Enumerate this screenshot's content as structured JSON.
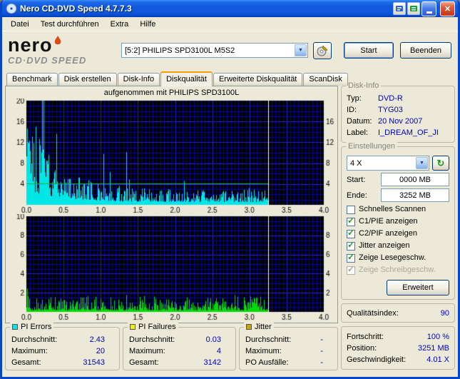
{
  "window": {
    "title": "Nero CD-DVD Speed 4.7.7.3"
  },
  "icons": {
    "chevron_down": "▼",
    "refresh": "↻",
    "close": "✕",
    "write_test": "✎"
  },
  "menu": {
    "items": [
      "Datei",
      "Test durchführen",
      "Extra",
      "Hilfe"
    ]
  },
  "logo": {
    "line1": "nero",
    "line2": "CD·DVD SPEED"
  },
  "toolbar": {
    "drive": "[5:2]  PHILIPS SPD3100L M5S2",
    "start_label": "Start",
    "quit_label": "Beenden"
  },
  "tabs": {
    "items": [
      "Benchmark",
      "Disk erstellen",
      "Disk-Info",
      "Diskqualität",
      "Erweiterte Diskqualität",
      "ScanDisk"
    ],
    "active_index": 3
  },
  "disk_info": {
    "title": "Disk-Info",
    "rows": [
      {
        "label": "Typ:",
        "value": "DVD-R"
      },
      {
        "label": "ID:",
        "value": "TYG03"
      },
      {
        "label": "Datum:",
        "value": "20 Nov 2007"
      },
      {
        "label": "Label:",
        "value": "I_DREAM_OF_JI"
      }
    ]
  },
  "settings": {
    "title": "Einstellungen",
    "speed_value": "4 X",
    "start_label": "Start:",
    "start_value": "0000 MB",
    "end_label": "Ende:",
    "end_value": "3252 MB",
    "checkboxes": [
      {
        "label": "Schnelles Scannen",
        "checked": false,
        "disabled": false
      },
      {
        "label": "C1/PIE anzeigen",
        "checked": true,
        "disabled": false
      },
      {
        "label": "C2/PIF anzeigen",
        "checked": true,
        "disabled": false
      },
      {
        "label": "Jitter anzeigen",
        "checked": true,
        "disabled": false
      },
      {
        "label": "Zeige Lesegeschw.",
        "checked": true,
        "disabled": false
      },
      {
        "label": "Zeige Schreibgeschw.",
        "checked": true,
        "disabled": true
      }
    ],
    "advanced_label": "Erweitert"
  },
  "quality": {
    "label": "Qualitätsindex:",
    "value": "90"
  },
  "progress": {
    "rows": [
      {
        "label": "Fortschritt:",
        "value": "100 %"
      },
      {
        "label": "Position:",
        "value": "3251 MB"
      },
      {
        "label": "Geschwindigkeit:",
        "value": "4.01 X"
      }
    ]
  },
  "stats": [
    {
      "title": "PI Errors",
      "color": "#00E6E6",
      "rows": [
        {
          "label": "Durchschnitt:",
          "value": "2.43"
        },
        {
          "label": "Maximum:",
          "value": "20"
        },
        {
          "label": "Gesamt:",
          "value": "31543"
        }
      ]
    },
    {
      "title": "PI Failures",
      "color": "#F0F000",
      "rows": [
        {
          "label": "Durchschnitt:",
          "value": "0.03"
        },
        {
          "label": "Maximum:",
          "value": "4"
        },
        {
          "label": "Gesamt:",
          "value": "3142"
        }
      ]
    },
    {
      "title": "Jitter",
      "color": "#C8A800",
      "rows": [
        {
          "label": "Durchschnitt:",
          "value": "-"
        },
        {
          "label": "Maximum:",
          "value": "-"
        },
        {
          "label": "PO Ausfälle:",
          "value": "-"
        }
      ]
    }
  ],
  "chart_data": [
    {
      "type": "area",
      "name": "pie",
      "title": "aufgenommen mit PHILIPS SPD3100L",
      "ylim": [
        0,
        20
      ],
      "xlim": [
        0,
        4
      ],
      "left_ticks": [
        4,
        8,
        12,
        16,
        20
      ],
      "right_ticks": [
        4,
        8,
        12,
        16
      ],
      "x_ticks": [
        "0.0",
        "0.5",
        "1.0",
        "1.5",
        "2.0",
        "2.5",
        "3.0",
        "3.5",
        "4.0"
      ],
      "hstep": 1,
      "hmajor": 4,
      "data_end_x": 3.25,
      "bg": "#000000",
      "grid": "#0000A0",
      "grid_major": "#2020D8",
      "seed": 20071120,
      "series": [
        {
          "name": "PI Errors",
          "color": "#00E6E6",
          "average": 2.43,
          "maximum": 20,
          "total": 31543
        },
        {
          "name": "Lesegeschwindigkeit",
          "color": "#00B43C",
          "type": "line",
          "speed_x": 4.01
        }
      ],
      "speed_line": 4.1
    },
    {
      "type": "area",
      "name": "pif",
      "ylim": [
        0,
        10
      ],
      "xlim": [
        0,
        4
      ],
      "left_ticks": [
        2,
        4,
        6,
        8,
        10
      ],
      "right_ticks": [
        2,
        4,
        6,
        8
      ],
      "x_ticks": [
        "0.0",
        "0.5",
        "1.0",
        "1.5",
        "2.0",
        "2.5",
        "3.0",
        "3.5",
        "4.0"
      ],
      "hstep": 0.5,
      "hmajor": 2,
      "data_end_x": 3.25,
      "bg": "#000000",
      "grid": "#0000A0",
      "grid_major": "#2020D8",
      "seed": 31421,
      "series": [
        {
          "name": "PI Failures",
          "color": "#00DC00",
          "average": 0.03,
          "maximum": 4,
          "total": 3142
        }
      ]
    }
  ]
}
